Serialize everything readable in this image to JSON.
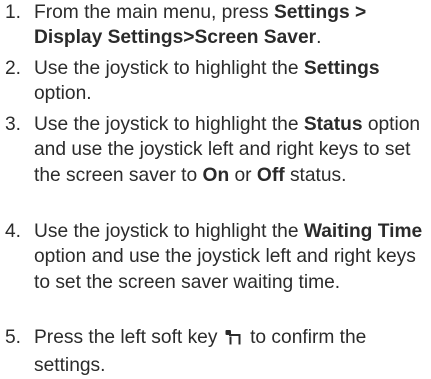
{
  "steps": [
    {
      "number": "1.",
      "parts": [
        "From the main menu, press ",
        "Settings > Display Settings>Screen Saver",
        "."
      ]
    },
    {
      "number": "2.",
      "parts": [
        "Use the joystick to highlight the ",
        "Settings",
        " option."
      ]
    },
    {
      "number": "3.",
      "parts": [
        "Use the joystick to highlight the ",
        "Status",
        " option and use the joystick left and right keys to set the screen saver to ",
        "On",
        " or ",
        "Off",
        " status."
      ]
    },
    {
      "number": "4.",
      "parts": [
        "Use the joystick to highlight the ",
        "Waiting Time",
        " option and use the joystick left and right keys to set the screen saver waiting time."
      ]
    },
    {
      "number": "5.",
      "parts": [
        "Press the left soft key ",
        " to confirm the settings."
      ],
      "icon": "left-soft-key-icon"
    }
  ]
}
